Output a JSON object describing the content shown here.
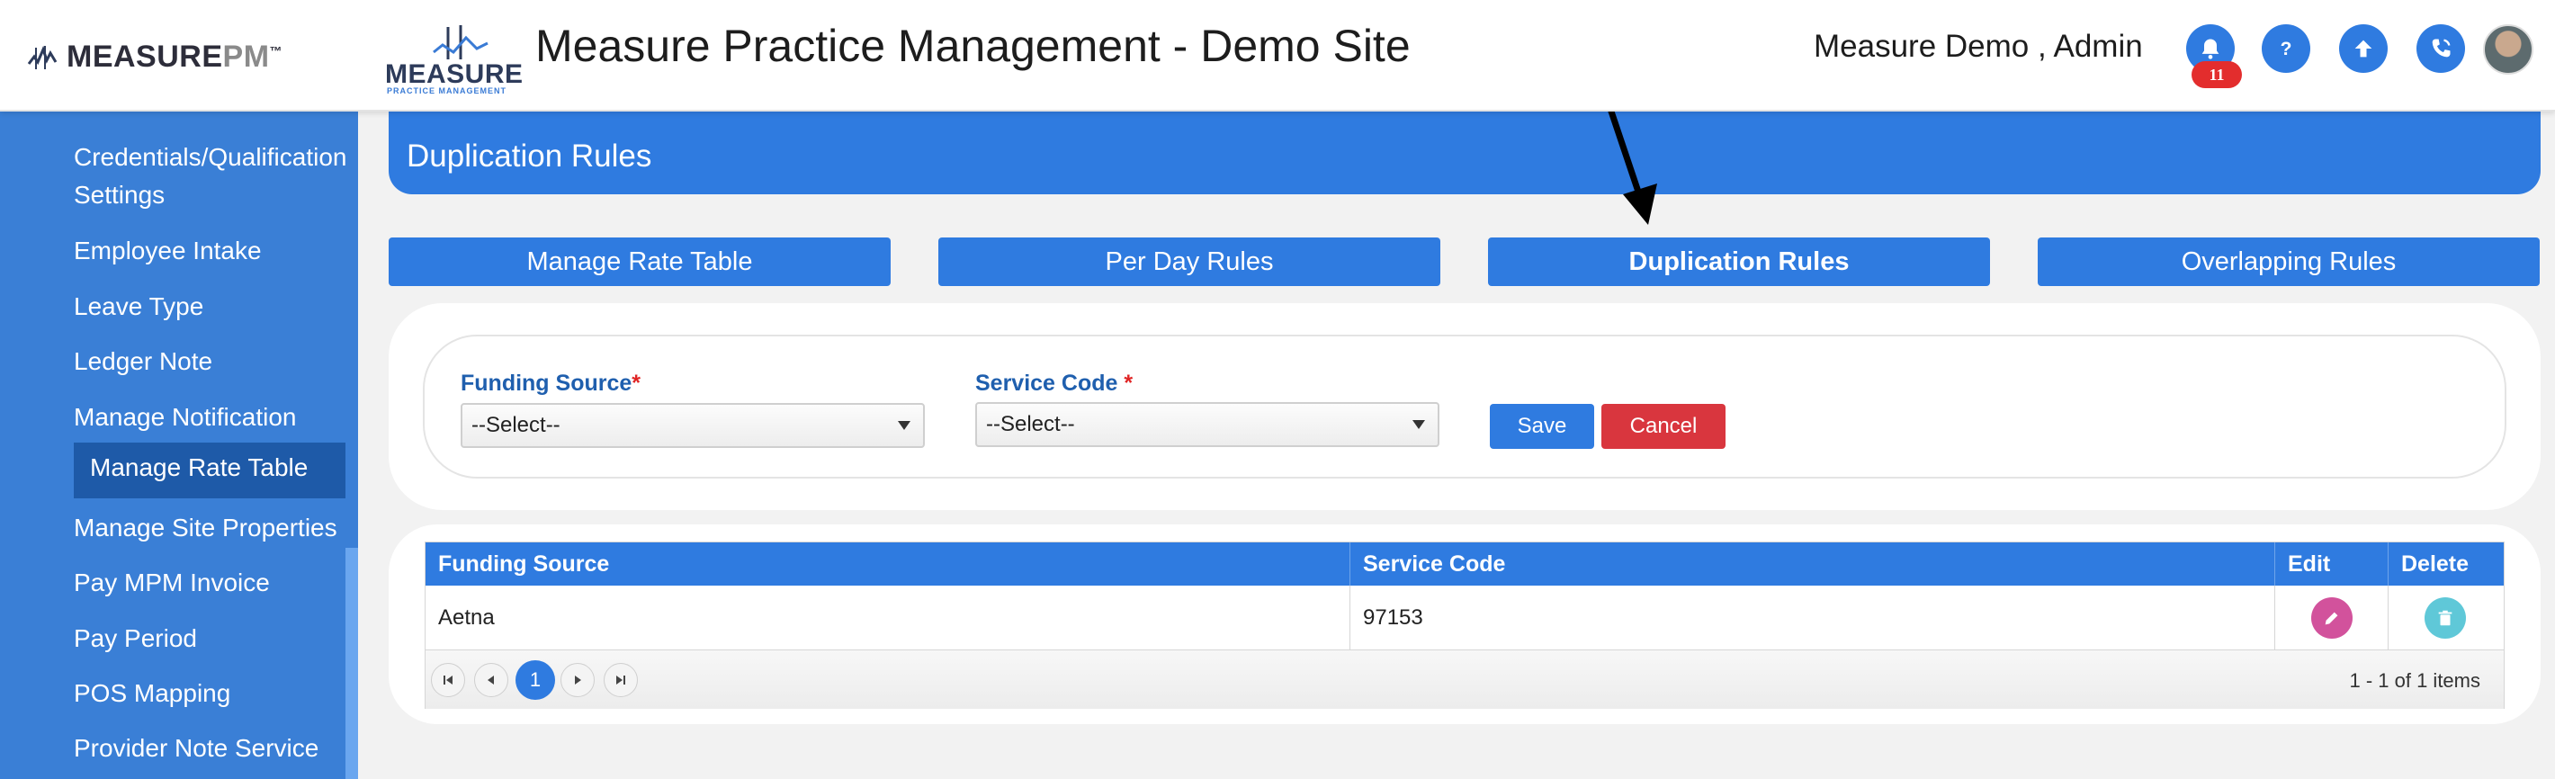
{
  "header": {
    "brand_main": "MEASURE",
    "brand_suffix": "PM",
    "brand_tm": "™",
    "logo2_word": "MEASURE",
    "logo2_sub": "PRACTICE MANAGEMENT",
    "site_title": "Measure Practice Management - Demo Site",
    "user_name": "Measure Demo , Admin",
    "notification_count": "11",
    "icons": [
      "bell-icon",
      "help-icon",
      "upload-icon",
      "phone-icon",
      "avatar"
    ]
  },
  "sidebar": {
    "items": [
      {
        "label": "Credentials/Qualification"
      },
      {
        "label": "Settings"
      },
      {
        "label": "Employee Intake"
      },
      {
        "label": "Leave Type"
      },
      {
        "label": "Ledger Note"
      },
      {
        "label": "Manage Notification"
      },
      {
        "label": "Manage Rate Table",
        "active": true
      },
      {
        "label": "Manage Site Properties"
      },
      {
        "label": "Pay MPM Invoice"
      },
      {
        "label": "Pay Period"
      },
      {
        "label": "POS Mapping"
      },
      {
        "label": "Provider Note Service"
      }
    ]
  },
  "page": {
    "title": "Duplication Rules",
    "tabs": [
      {
        "label": "Manage Rate Table"
      },
      {
        "label": "Per Day Rules"
      },
      {
        "label": "Duplication Rules",
        "active": true
      },
      {
        "label": "Overlapping Rules"
      }
    ]
  },
  "form": {
    "funding_source_label": "Funding Source",
    "service_code_label": "Service Code ",
    "required_mark": "*",
    "funding_source_value": "--Select--",
    "service_code_value": "--Select--",
    "save_label": "Save",
    "cancel_label": "Cancel"
  },
  "grid": {
    "columns": [
      "Funding Source",
      "Service Code",
      "Edit",
      "Delete"
    ],
    "rows": [
      {
        "funding_source": "Aetna",
        "service_code": "97153"
      }
    ],
    "current_page": "1",
    "summary": "1 - 1 of 1 items"
  },
  "colors": {
    "primary": "#2f7be0",
    "sidebar": "#3a7fd6",
    "sidebar_active": "#1e5aa8",
    "cancel": "#d9363e",
    "edit": "#d2529c",
    "delete": "#5fc8d8",
    "badge": "#e32d2d"
  }
}
